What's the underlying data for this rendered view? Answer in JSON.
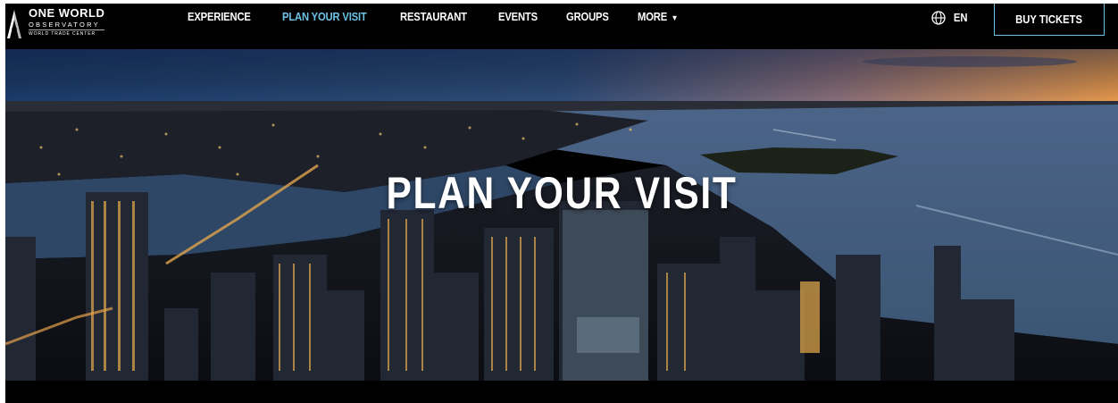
{
  "logo": {
    "main": "ONE WORLD",
    "sub": "OBSERVATORY",
    "sub2": "WORLD TRADE CENTER"
  },
  "nav": {
    "items": [
      {
        "label": "EXPERIENCE",
        "active": false
      },
      {
        "label": "PLAN YOUR VISIT",
        "active": true
      },
      {
        "label": "RESTAURANT",
        "active": false
      },
      {
        "label": "EVENTS",
        "active": false
      },
      {
        "label": "GROUPS",
        "active": false
      },
      {
        "label": "MORE",
        "active": false
      }
    ],
    "language": "EN",
    "buy_label": "BUY TICKETS"
  },
  "hero": {
    "title": "PLAN YOUR VISIT",
    "image": "aerial-city-night-skyline"
  },
  "colors": {
    "accent": "#6ec2e6",
    "background": "#000000",
    "text": "#ffffff"
  }
}
